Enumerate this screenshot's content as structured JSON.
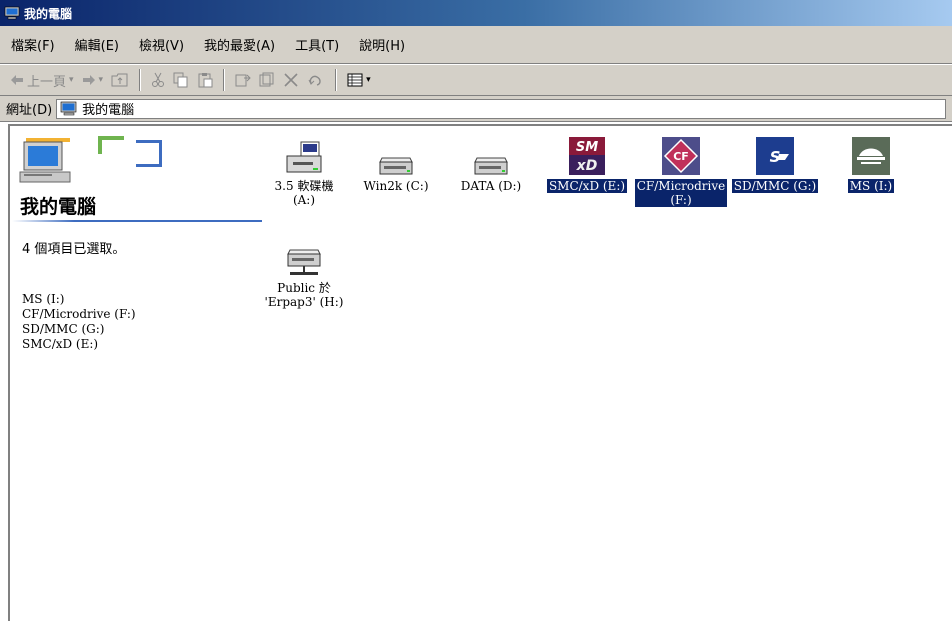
{
  "window": {
    "title": "我的電腦"
  },
  "menu": [
    {
      "label": "檔案(F)"
    },
    {
      "label": "編輯(E)"
    },
    {
      "label": "檢視(V)"
    },
    {
      "label": "我的最愛(A)"
    },
    {
      "label": "工具(T)"
    },
    {
      "label": "說明(H)"
    }
  ],
  "toolbar": {
    "back_label": "上一頁"
  },
  "address": {
    "label": "網址(D)",
    "value": "我的電腦"
  },
  "left_pane": {
    "title": "我的電腦",
    "status": "4 個項目已選取。",
    "selected_items": [
      "MS (I:)",
      "CF/Microdrive (F:)",
      "SD/MMC (G:)",
      "SMC/xD (E:)"
    ]
  },
  "drives": [
    {
      "line1": "3.5 軟碟機",
      "line2": "(A:)",
      "icon": "floppy-drive-icon",
      "selected": false
    },
    {
      "line1": "Win2k (C:)",
      "line2": "",
      "icon": "hard-drive-icon",
      "selected": false
    },
    {
      "line1": "DATA (D:)",
      "line2": "",
      "icon": "hard-drive-icon",
      "selected": false
    },
    {
      "line1": "SMC/xD (E:)",
      "line2": "",
      "icon": "smartmedia-xd-icon",
      "selected": true
    },
    {
      "line1": "CF/Microdrive",
      "line2": "(F:)",
      "icon": "compactflash-icon",
      "selected": true
    },
    {
      "line1": "SD/MMC (G:)",
      "line2": "",
      "icon": "sd-card-icon",
      "selected": true
    },
    {
      "line1": "MS (I:)",
      "line2": "",
      "icon": "memory-stick-icon",
      "selected": true
    },
    {
      "line1": "Public 於",
      "line2": "'Erpap3' (H:)",
      "icon": "network-drive-icon",
      "selected": false
    }
  ],
  "colors": {
    "selection": "#0a246a",
    "title_bar": "#0a246a",
    "chrome": "#d4d0c8"
  }
}
